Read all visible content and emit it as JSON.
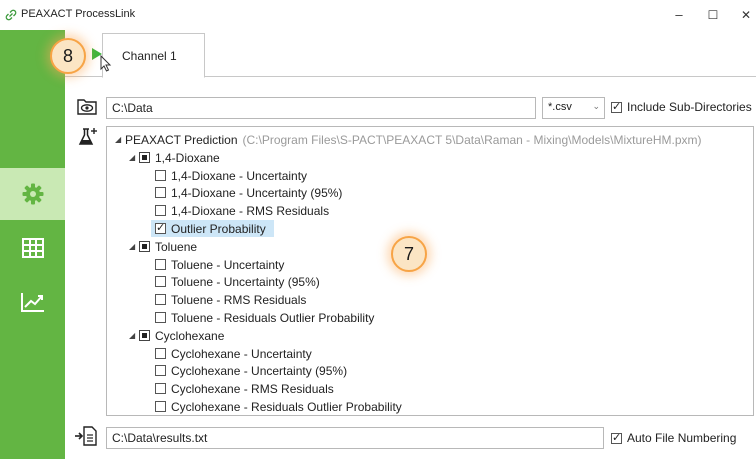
{
  "window": {
    "title": "PEAXACT ProcessLink",
    "minimize": "–",
    "maximize": "☐",
    "close": "✕"
  },
  "tabs": [
    {
      "label": "Channel 1"
    }
  ],
  "badges": {
    "run": "8",
    "tree": "7"
  },
  "input": {
    "path": "C:\\Data",
    "filetype": "*.csv",
    "include_subdirs_label": "Include Sub-Directories",
    "include_subdirs_checked": true
  },
  "tree": {
    "root_label": "PEAXACT Prediction",
    "root_path": "(C:\\Program Files\\S-PACT\\PEAXACT 5\\Data\\Raman - Mixing\\Models\\MixtureHM.pxm)",
    "groups": [
      {
        "label": "1,4-Dioxane",
        "items": [
          {
            "label": "1,4-Dioxane - Uncertainty",
            "checked": false
          },
          {
            "label": "1,4-Dioxane - Uncertainty (95%)",
            "checked": false
          },
          {
            "label": "1,4-Dioxane - RMS Residuals",
            "checked": false
          },
          {
            "label": "Outlier Probability",
            "checked": true
          }
        ]
      },
      {
        "label": "Toluene",
        "items": [
          {
            "label": "Toluene - Uncertainty",
            "checked": false
          },
          {
            "label": "Toluene - Uncertainty (95%)",
            "checked": false
          },
          {
            "label": "Toluene - RMS Residuals",
            "checked": false
          },
          {
            "label": "Toluene - Residuals Outlier Probability",
            "checked": false
          }
        ]
      },
      {
        "label": "Cyclohexane",
        "items": [
          {
            "label": "Cyclohexane - Uncertainty",
            "checked": false
          },
          {
            "label": "Cyclohexane - Uncertainty (95%)",
            "checked": false
          },
          {
            "label": "Cyclohexane - RMS Residuals",
            "checked": false
          },
          {
            "label": "Cyclohexane - Residuals Outlier Probability",
            "checked": false
          }
        ]
      }
    ]
  },
  "output": {
    "path": "C:\\Data\\results.txt",
    "auto_numbering_label": "Auto File Numbering",
    "auto_numbering_checked": true
  },
  "colors": {
    "sidebar": "#63b543",
    "sidebar_active": "#c9e9b4",
    "play": "#3cb43c",
    "badge_border": "#f7a446",
    "selection": "#cde6f7"
  },
  "icons": {
    "app": "link-icon",
    "settings": "gear-icon",
    "table": "table-icon",
    "chart": "trend-chart-icon",
    "input_folder": "folder-eye-icon",
    "prediction": "flask-plus-icon",
    "output_file": "file-export-icon",
    "run": "play-icon",
    "cursor": "mouse-pointer-icon"
  }
}
